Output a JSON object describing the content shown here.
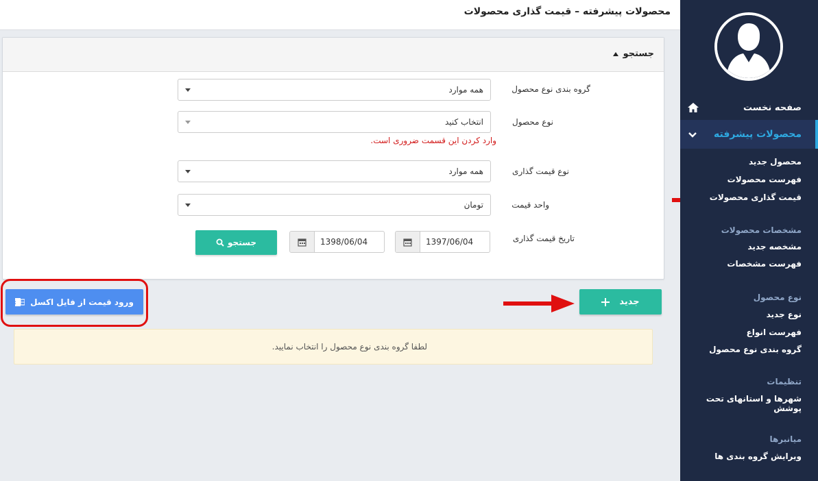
{
  "page": {
    "title": "محصولات پیشرفته – قیمت گذاری محصولات"
  },
  "sidebar": {
    "home": "صفحه نخست",
    "active_section": "محصولات پیشرفته",
    "products_items": [
      "محصول جدید",
      "فهرست محصولات",
      "قیمت گذاری محصولات"
    ],
    "sections": [
      {
        "title": "مشخصات محصولات",
        "items": [
          "مشخصه جدید",
          "فهرست مشخصات"
        ]
      },
      {
        "title": "نوع محصول",
        "items": [
          "نوع جدید",
          "فهرست انواع",
          "گروه بندی نوع محصول"
        ]
      },
      {
        "title": "تنظیمات",
        "items": [
          "شهرها و استانهای تحت پوشش"
        ]
      },
      {
        "title": "میانبرها",
        "items": [
          "ویرایش گروه بندی ها"
        ]
      }
    ]
  },
  "search": {
    "panel_title": "جستجو",
    "fields": {
      "group_label": "گروه بندی نوع محصول",
      "group_value": "همه موارد",
      "type_label": "نوع محصول",
      "type_value": "انتخاب کنید",
      "type_error": "وارد کردن این قسمت ضروری است.",
      "pricing_type_label": "نوع قیمت گذاری",
      "pricing_type_value": "همه موارد",
      "unit_label": "واحد قیمت",
      "unit_value": "تومان",
      "date_label": "تاریخ قیمت گذاری",
      "date_from": "1397/06/04",
      "date_to": "1398/06/04"
    },
    "search_button": "جستجو"
  },
  "actions": {
    "new_button": "جدید",
    "excel_button": "ورود قیمت از فایل اکسل"
  },
  "alert": {
    "message": "لطفا گروه بندی نوع محصول را انتخاب نمایید."
  },
  "colors": {
    "sidebar_bg": "#1e2a44",
    "accent": "#2ea8e0",
    "teal": "#2bbba0",
    "blue": "#4e8ef0",
    "highlight_red": "#e01010"
  }
}
